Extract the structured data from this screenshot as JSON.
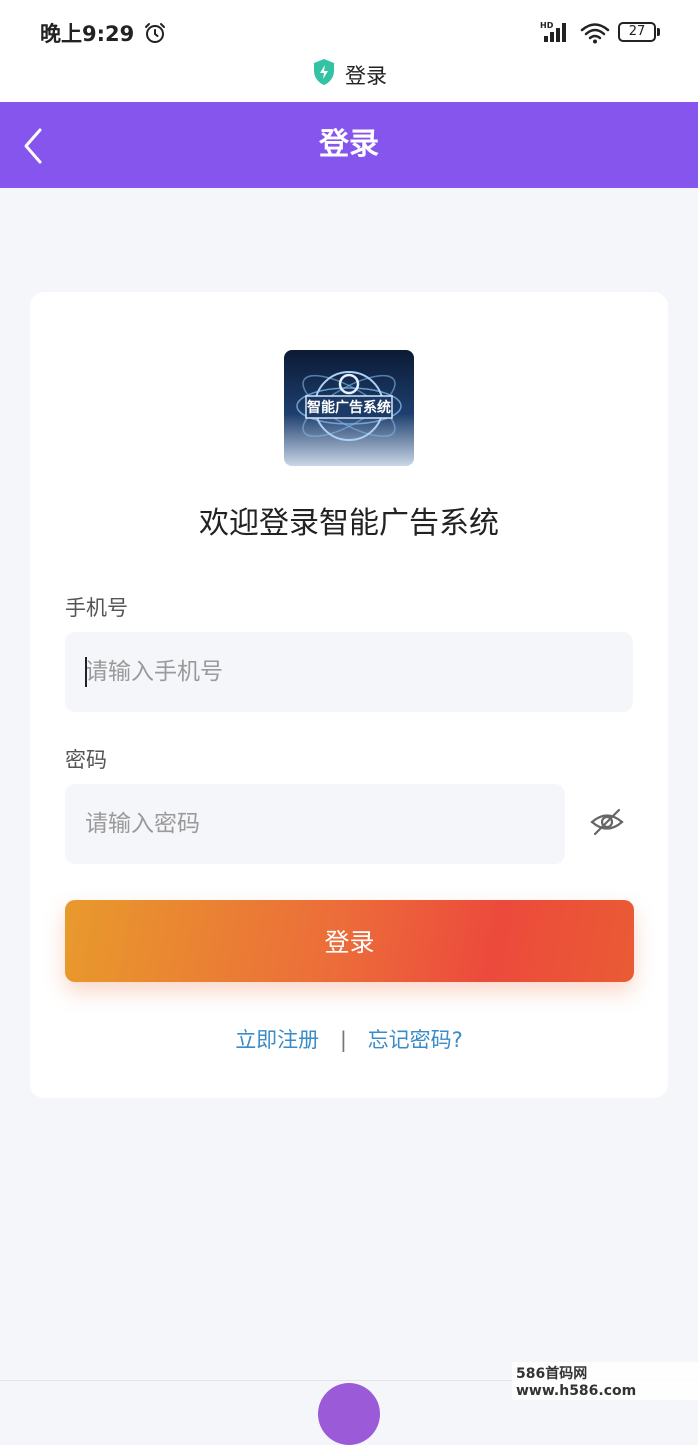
{
  "status_bar": {
    "time": "晚上9:29",
    "network_label": "HD",
    "battery": "27"
  },
  "page_label": "登录",
  "header": {
    "title": "登录",
    "back_icon": "chevron-left-icon",
    "color": "#8655ee"
  },
  "logo": {
    "text": "智能广告系统"
  },
  "welcome": "欢迎登录智能广告系统",
  "form": {
    "phone_label": "手机号",
    "phone_placeholder": "请输入手机号",
    "password_label": "密码",
    "password_placeholder": "请输入密码",
    "password_toggle_icon": "eye-off-icon",
    "login_button": "登录"
  },
  "links": {
    "register": "立即注册",
    "separator": "|",
    "forgot": "忘记密码?"
  },
  "watermark": "586首码网 www.h586.com"
}
